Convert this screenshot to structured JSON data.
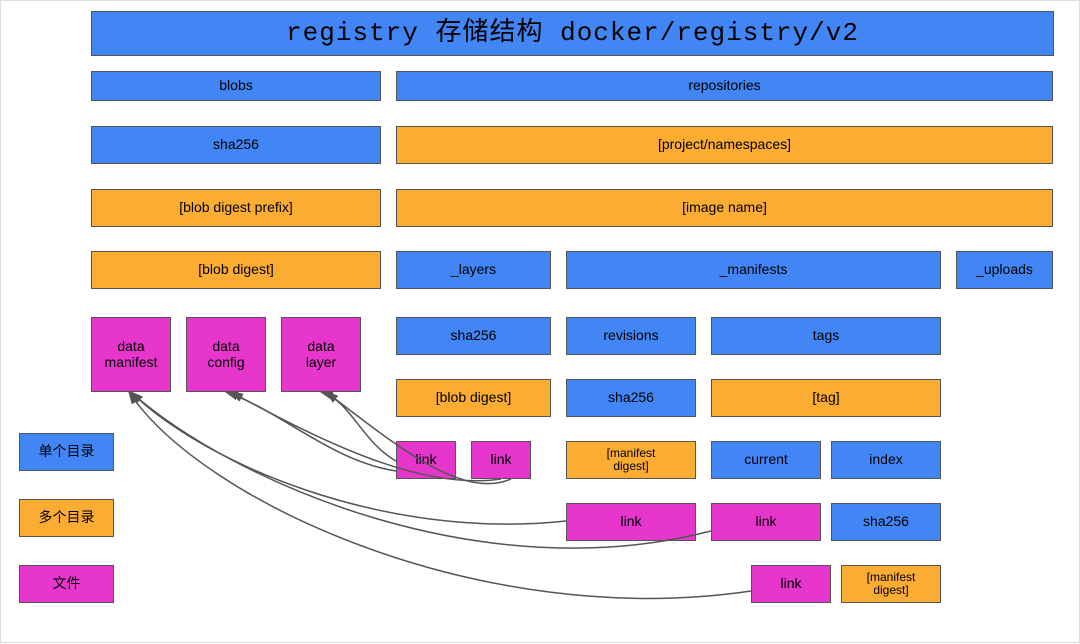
{
  "title": "registry 存储结构 docker/registry/v2",
  "row2": {
    "blobs": "blobs",
    "repositories": "repositories"
  },
  "row3": {
    "sha256": "sha256",
    "proj": "[project/namespaces]"
  },
  "row4": {
    "prefix": "[blob digest prefix]",
    "image": "[image name]"
  },
  "row5": {
    "digest": "[blob digest]",
    "layers": "_layers",
    "manifests": "_manifests",
    "uploads": "_uploads"
  },
  "row6": {
    "dmanifest": "data\nmanifest",
    "dconfig": "data\nconfig",
    "dlayer": "data\nlayer",
    "sha256l": "sha256",
    "revisions": "revisions",
    "tags": "tags"
  },
  "row7": {
    "blobdigest": "[blob digest]",
    "sha256m": "sha256",
    "tag": "[tag]"
  },
  "row8": {
    "link1": "link",
    "link2": "link",
    "mdigest": "[manifest\ndigest]",
    "current": "current",
    "index": "index"
  },
  "row9": {
    "link3": "link",
    "link4": "link",
    "sha256i": "sha256"
  },
  "row10": {
    "link5": "link",
    "mdigest2": "[manifest\ndigest]"
  },
  "legend": {
    "single": "单个目录",
    "multi": "多个目录",
    "file": "文件"
  }
}
